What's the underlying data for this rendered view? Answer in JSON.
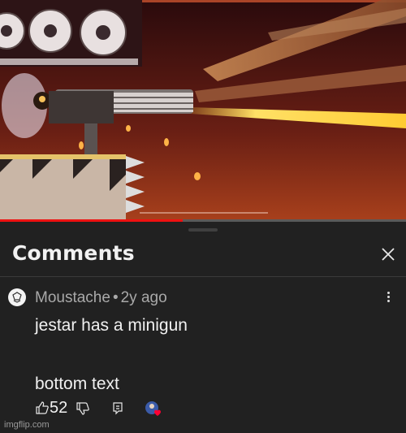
{
  "comments_panel": {
    "title": "Comments",
    "close_icon": "close-icon"
  },
  "comment": {
    "author": "Moustache",
    "separator": "•",
    "age": "2y ago",
    "text": "jestar has a minigun\n\nbottom text",
    "likes": "52",
    "icons": [
      "thumbs-up-icon",
      "thumbs-down-icon",
      "reply-icon",
      "creator-heart-icon",
      "more-options-icon"
    ]
  },
  "video": {
    "progress_fraction": 0.45
  },
  "watermark": "imgflip.com",
  "colors": {
    "panel_bg": "#212121",
    "progress": "#ee1111",
    "heart": "#ff0033"
  }
}
